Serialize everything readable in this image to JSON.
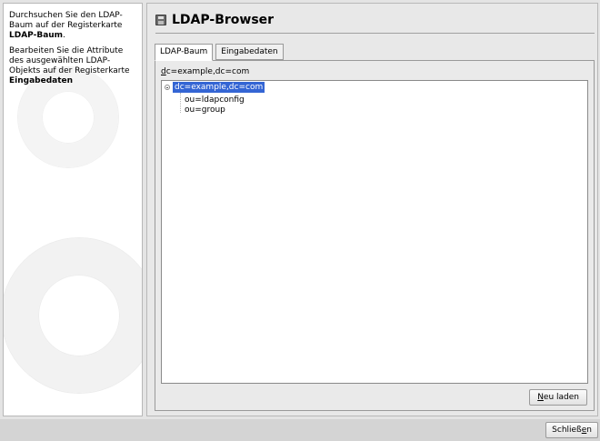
{
  "help": {
    "p1_before": "Durchsuchen Sie den LDAP-Baum auf der Registerkarte ",
    "p1_bold": "LDAP-Baum",
    "p1_after": ".",
    "p2_before": "Bearbeiten Sie die Attribute des ausgewählten LDAP-Objekts auf der Registerkarte ",
    "p2_bold": "Eingabedaten"
  },
  "header": {
    "title": "LDAP-Browser",
    "icon": "disk-icon"
  },
  "tabs": [
    {
      "label": "LDAP-Baum",
      "selected": true
    },
    {
      "label": "Eingabedaten",
      "selected": false
    }
  ],
  "tree": {
    "path_mnemonic": "d",
    "path_rest": "c=example,dc=com",
    "root": {
      "label": "dc=example,dc=com",
      "selected": true
    },
    "children": [
      "ou=ldapconfig",
      "ou=group"
    ]
  },
  "buttons": {
    "reload_mnemonic": "N",
    "reload_rest": "eu laden",
    "close_before": "Schließ",
    "close_mnemonic": "e",
    "close_after": "n"
  },
  "colors": {
    "selection": "#3465d4"
  }
}
